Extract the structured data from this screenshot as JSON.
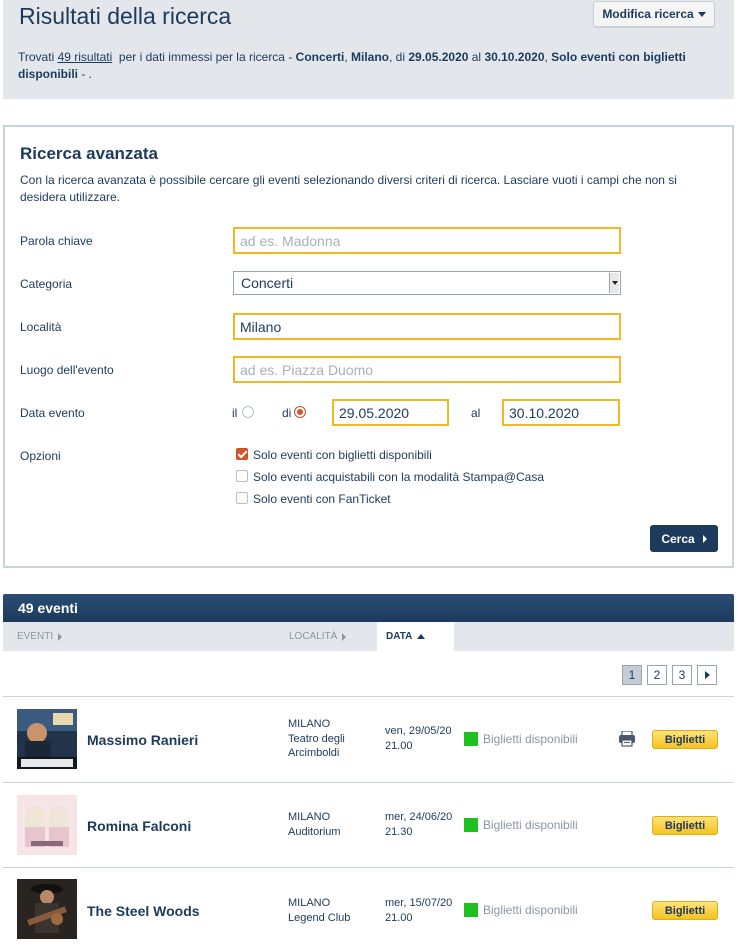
{
  "header": {
    "title": "Risultati della ricerca",
    "modify_label": "Modifica ricerca",
    "summary": {
      "prefix": "Trovati ",
      "count_link": "49 risultati",
      "middle": "  per i dati immessi per la ricerca - ",
      "category": "Concerti",
      "sep1": ", ",
      "city": "Milano",
      "sep2": ", di ",
      "date_from": "29.05.2020",
      "sep3": " al ",
      "date_to": "30.10.2020",
      "sep4": ", ",
      "option": "Solo eventi con biglietti disponibili",
      "suffix": " - ."
    }
  },
  "advanced": {
    "title": "Ricerca avanzata",
    "intro": "Con la ricerca avanzata è possibile cercare gli eventi selezionando diversi criteri di ricerca. Lasciare vuoti i campi che non si desidera utilizzare.",
    "keyword": {
      "label": "Parola chiave",
      "placeholder": "ad es. Madonna",
      "value": ""
    },
    "category": {
      "label": "Categoria",
      "value": "Concerti"
    },
    "city": {
      "label": "Località",
      "value": "Milano"
    },
    "venue": {
      "label": "Luogo dell'evento",
      "placeholder": "ad es. Piazza Duomo",
      "value": ""
    },
    "date": {
      "label": "Data evento",
      "option_on": "il",
      "option_from": "di",
      "selected": "di",
      "from": "29.05.2020",
      "to_label": "al",
      "to": "30.10.2020"
    },
    "options": {
      "label": "Opzioni",
      "items": [
        {
          "label": "Solo eventi con biglietti disponibili",
          "checked": true
        },
        {
          "label": "Solo eventi acquistabili con la modalità Stampa@Casa",
          "checked": false
        },
        {
          "label": "Solo eventi con FanTicket",
          "checked": false
        }
      ]
    },
    "search_label": "Cerca"
  },
  "results": {
    "count_label": "49 eventi",
    "columns": {
      "events": "EVENTI",
      "location": "LOCALITÀ",
      "date": "DATA"
    },
    "sort_active": "date",
    "pages": [
      "1",
      "2",
      "3"
    ],
    "current_page": "1",
    "rows": [
      {
        "title": "Massimo Ranieri",
        "city": "MILANO",
        "venue_lines": [
          "Teatro degli",
          "Arcimboldi"
        ],
        "date": "ven, 29/05/20",
        "time": "21.00",
        "status": "Biglietti disponibili",
        "status_color": "#21c021",
        "print_at_home": true,
        "button": "Biglietti"
      },
      {
        "title": "Romina Falconi",
        "city": "MILANO",
        "venue_lines": [
          "Auditorium"
        ],
        "date": "mer, 24/06/20",
        "time": "21.30",
        "status": "Biglietti disponibili",
        "status_color": "#21c021",
        "print_at_home": false,
        "button": "Biglietti"
      },
      {
        "title": "The Steel Woods",
        "city": "MILANO",
        "venue_lines": [
          "Legend Club"
        ],
        "date": "mer, 15/07/20",
        "time": "21.00",
        "status": "Biglietti disponibili",
        "status_color": "#21c021",
        "print_at_home": false,
        "button": "Biglietti"
      }
    ]
  },
  "colors": {
    "brand_navy": "#1c3a5c",
    "accent_orange": "#d9542b",
    "field_border": "#f0b822",
    "available_green": "#21c021",
    "ticket_yellow": "#f4c320"
  }
}
